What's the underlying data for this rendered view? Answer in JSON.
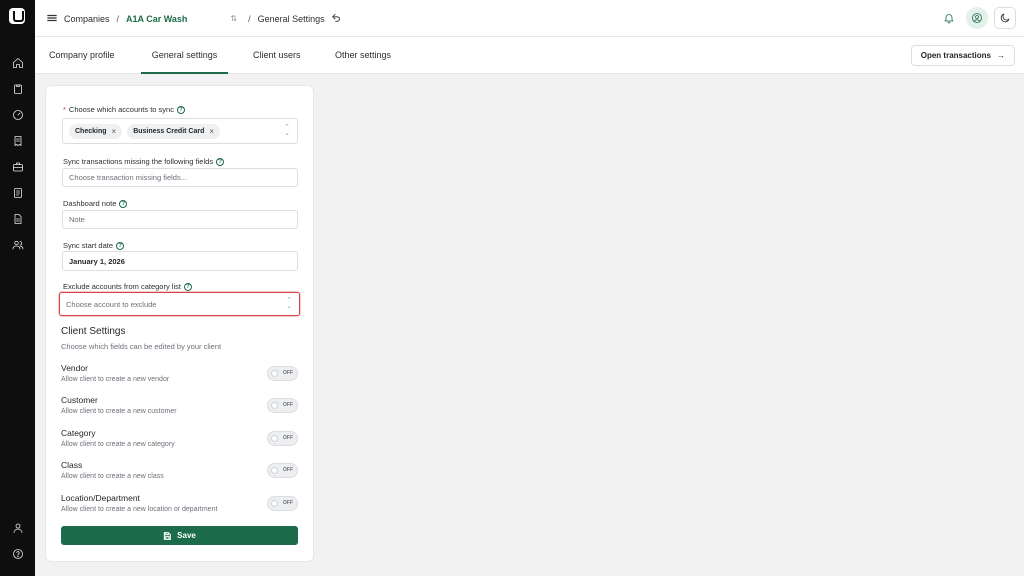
{
  "breadcrumb": {
    "companies_label": "Companies",
    "separator": "/",
    "company_name": "A1A Car Wash",
    "page_name": "General Settings"
  },
  "tabs": [
    {
      "label": "Company profile",
      "active": false
    },
    {
      "label": "General settings",
      "active": true
    },
    {
      "label": "Client users",
      "active": false
    },
    {
      "label": "Other settings",
      "active": false
    }
  ],
  "open_transactions_label": "Open transactions",
  "form": {
    "accounts_to_sync": {
      "label": "Choose which accounts to sync",
      "required_marker": "*",
      "chips": [
        "Checking",
        "Business Credit Card"
      ]
    },
    "missing_fields": {
      "label": "Sync transactions missing the following fields",
      "placeholder": "Choose transaction missing fields..."
    },
    "dashboard_note": {
      "label": "Dashboard note",
      "placeholder": "Note"
    },
    "sync_start_date": {
      "label": "Sync start date",
      "value": "January 1, 2026"
    },
    "exclude_accounts": {
      "label": "Exclude accounts from category list",
      "placeholder": "Choose account to exclude"
    }
  },
  "client_settings": {
    "title": "Client Settings",
    "subtitle": "Choose which fields can be edited by your client",
    "items": [
      {
        "name": "Vendor",
        "desc": "Allow client to create a new vendor",
        "toggle": "OFF"
      },
      {
        "name": "Customer",
        "desc": "Allow client to create a new customer",
        "toggle": "OFF"
      },
      {
        "name": "Category",
        "desc": "Allow client to create a new category",
        "toggle": "OFF"
      },
      {
        "name": "Class",
        "desc": "Allow client to create a new class",
        "toggle": "OFF"
      },
      {
        "name": "Location/Department",
        "desc": "Allow client to create a new location or department",
        "toggle": "OFF"
      }
    ]
  },
  "save_label": "Save",
  "colors": {
    "brand_green": "#1c6b4a",
    "highlight_red": "#d64545",
    "rail_bg": "#0e0e0e"
  },
  "icons": {
    "rail": [
      "home-icon",
      "clipboard-icon",
      "gauge-icon",
      "receipt-icon",
      "briefcase-icon",
      "document-icon",
      "file-text-icon",
      "users-icon",
      "user-icon",
      "help-icon"
    ],
    "top": [
      "bell-icon",
      "user-circle-icon",
      "moon-icon"
    ]
  }
}
